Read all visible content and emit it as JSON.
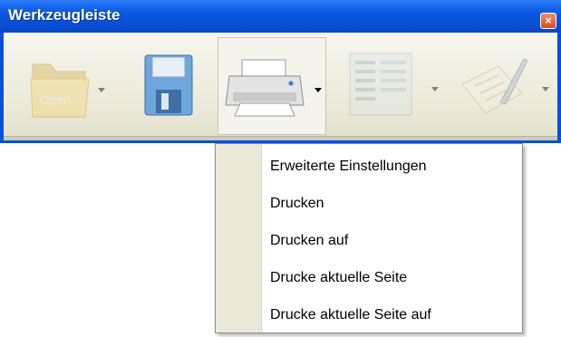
{
  "window": {
    "title": "Werkzeugleiste",
    "close_glyph": "×",
    "colors": {
      "titlebar": "#0b5ae6",
      "close": "#d94b1e",
      "toolbar_bg": "#ece9d8"
    }
  },
  "toolbar": {
    "tools": [
      {
        "id": "open",
        "label": "Open",
        "icon": "folder-icon",
        "has_dropdown": true,
        "enabled": false
      },
      {
        "id": "save",
        "icon": "floppy-disk-icon",
        "has_dropdown": false,
        "enabled": true
      },
      {
        "id": "print",
        "icon": "printer-icon",
        "has_dropdown": true,
        "enabled": true,
        "active": true
      },
      {
        "id": "preview",
        "icon": "page-preview-icon",
        "has_dropdown": true,
        "enabled": false
      },
      {
        "id": "edit",
        "icon": "document-pen-icon",
        "has_dropdown": true,
        "enabled": false
      }
    ]
  },
  "menu": {
    "items": [
      {
        "label": "Erweiterte Einstellungen"
      },
      {
        "label": "Drucken"
      },
      {
        "label": "Drucken auf"
      },
      {
        "label": "Drucke aktuelle Seite"
      },
      {
        "label": "Drucke aktuelle Seite auf"
      }
    ]
  }
}
